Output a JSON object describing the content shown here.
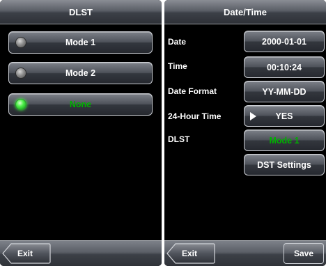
{
  "left_screen": {
    "title": "DLST",
    "options": [
      {
        "label": "Mode 1",
        "selected": false
      },
      {
        "label": "Mode 2",
        "selected": false
      },
      {
        "label": "None",
        "selected": true
      }
    ],
    "exit_label": "Exit"
  },
  "right_screen": {
    "title": "Date/Time",
    "rows": [
      {
        "label": "Date",
        "value": "2000-01-01"
      },
      {
        "label": "Time",
        "value": "00:10:24"
      },
      {
        "label": "Date Format",
        "value": "YY-MM-DD"
      },
      {
        "label": "24-Hour Time",
        "value": "YES"
      },
      {
        "label": "DLST",
        "value": "Mode 1"
      }
    ],
    "dst_settings_label": "DST Settings",
    "exit_label": "Exit",
    "save_label": "Save"
  },
  "colors": {
    "selected_text": "#00b000",
    "radio_on": "#44ff44",
    "background": "#000000"
  },
  "icons": {
    "radio": "radio-icon",
    "play": "play-triangle-icon",
    "back": "back-arrow-icon"
  }
}
